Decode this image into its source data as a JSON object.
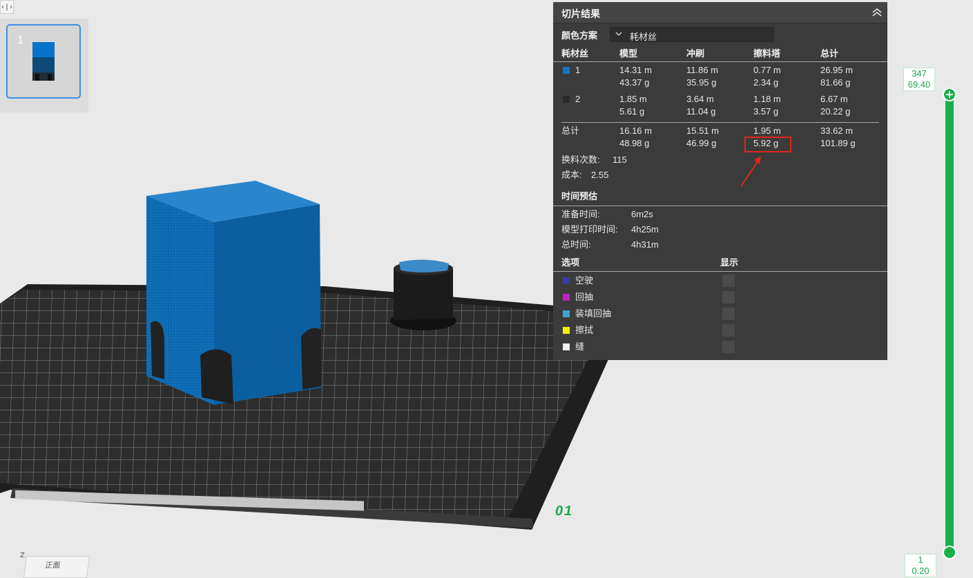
{
  "sidebar": {
    "plate_number": "1"
  },
  "panel": {
    "title": "切片结果",
    "color_scheme_label": "颜色方案",
    "color_scheme_value": "耗材丝",
    "columns": [
      "耗材丝",
      "模型",
      "冲刷",
      "擦料塔",
      "总计"
    ],
    "filaments": [
      {
        "id": "1",
        "color": "#1a74c4",
        "model": [
          "14.31 m",
          "43.37 g"
        ],
        "flush": [
          "11.86 m",
          "35.95 g"
        ],
        "tower": [
          "0.77 m",
          "2.34 g"
        ],
        "total": [
          "26.95 m",
          "81.66 g"
        ]
      },
      {
        "id": "2",
        "color": "#2b2b2b",
        "model": [
          "1.85 m",
          "5.61 g"
        ],
        "flush": [
          "3.64 m",
          "11.04 g"
        ],
        "tower": [
          "1.18 m",
          "3.57 g"
        ],
        "total": [
          "6.67 m",
          "20.22 g"
        ]
      }
    ],
    "total_row": {
      "label": "总计",
      "model": [
        "16.16 m",
        "48.98 g"
      ],
      "flush": [
        "15.51 m",
        "46.99 g"
      ],
      "tower": [
        "1.95 m",
        "5.92 g"
      ],
      "total": [
        "33.62 m",
        "101.89 g"
      ]
    },
    "change_count_label": "换料次数:",
    "change_count_value": "115",
    "cost_label": "成本:",
    "cost_value": "2.55",
    "time_section_title": "时间预估",
    "times": [
      {
        "label": "准备时间:",
        "value": "6m2s"
      },
      {
        "label": "模型打印时间:",
        "value": "4h25m"
      },
      {
        "label": "总时间:",
        "value": "4h31m"
      }
    ],
    "options_header": "选项",
    "display_header": "显示",
    "options": [
      {
        "label": "空驶",
        "color": "#3a3aa0"
      },
      {
        "label": "回抽",
        "color": "#c21fc2"
      },
      {
        "label": "装填回抽",
        "color": "#3ea2d6"
      },
      {
        "label": "擦拭",
        "color": "#f2f200"
      },
      {
        "label": "缝",
        "color": "#eeeeee"
      }
    ]
  },
  "layer_slider": {
    "top_layer": "347",
    "top_height": "69.40",
    "bottom_layer": "1",
    "bottom_height": "0.20",
    "color": "#19b04b"
  },
  "viewport": {
    "plate_label": "01",
    "axis_label": "Z",
    "view_cube_label": "正面",
    "model_color": "#0c69b0"
  }
}
